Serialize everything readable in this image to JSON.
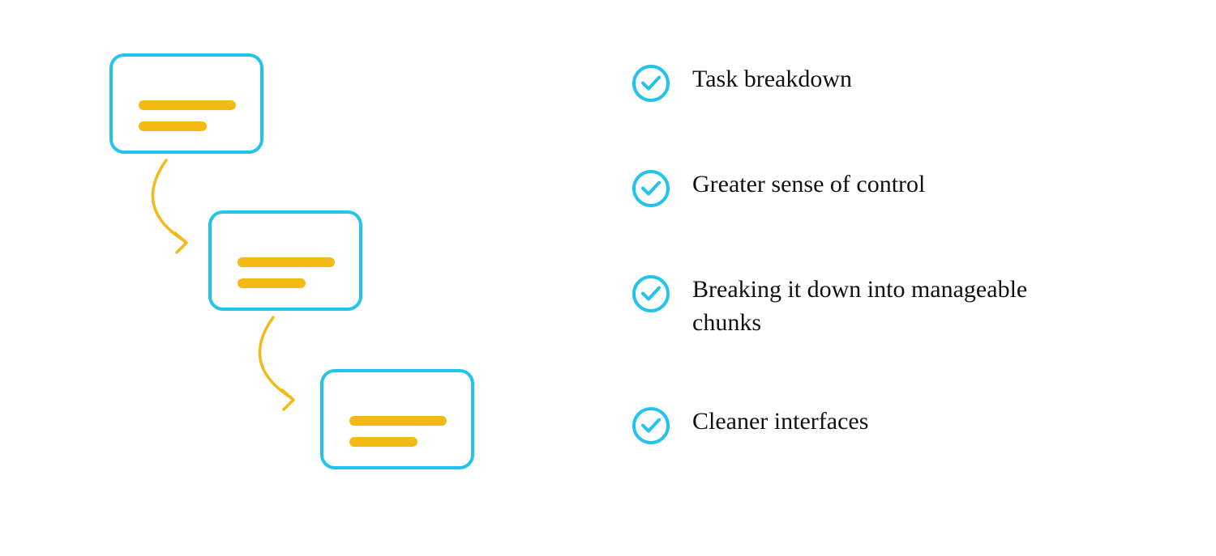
{
  "colors": {
    "accent": "#23c3ee",
    "highlight": "#f5b915",
    "text": "#111111"
  },
  "illustration": {
    "cards": 3
  },
  "benefits": [
    {
      "label": "Task breakdown"
    },
    {
      "label": "Greater sense of control"
    },
    {
      "label": "Breaking it down into manageable chunks"
    },
    {
      "label": "Cleaner interfaces"
    }
  ]
}
